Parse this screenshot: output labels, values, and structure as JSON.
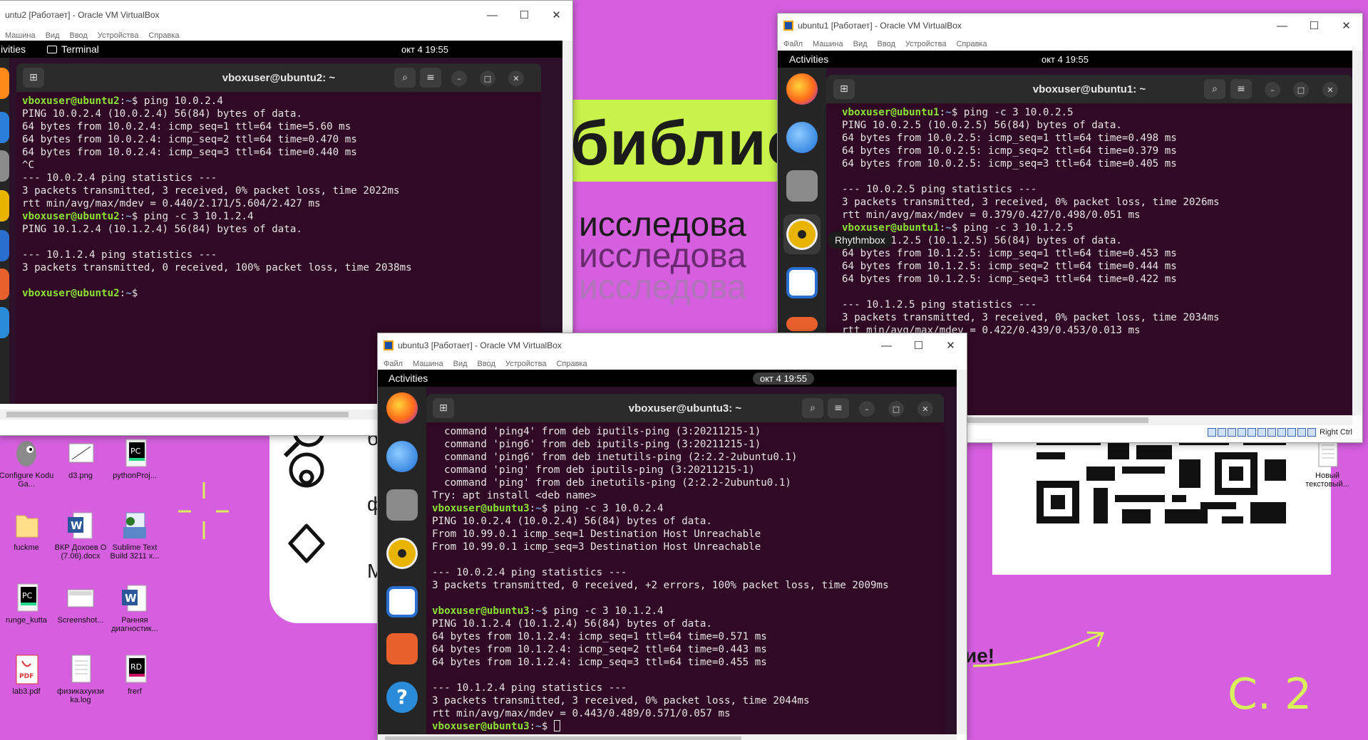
{
  "wallpaper": {
    "big_word": "библио",
    "research_lines": [
      "исследова",
      "исследова",
      "исследова"
    ],
    "side_letters": [
      "б",
      "ф",
      "М"
    ],
    "bottom_text": "ие!",
    "scribble": "С. 2"
  },
  "desktop_icons": [
    {
      "label": "Configure Kodu Ga...",
      "icon": "kodu-icon"
    },
    {
      "label": "d3.png",
      "icon": "image-file-icon"
    },
    {
      "label": "pythonProj...",
      "icon": "pycharm-icon"
    },
    {
      "label": "fuckme",
      "icon": "folder-icon"
    },
    {
      "label": "ВКР Дохоев О (7.06).docx",
      "icon": "word-icon"
    },
    {
      "label": "Sublime Text Build 3211 x...",
      "icon": "installer-icon"
    },
    {
      "label": "runge_kutta",
      "icon": "pycharm-icon"
    },
    {
      "label": "Screenshot...",
      "icon": "image-file-icon"
    },
    {
      "label": "Ранняя диагностик...",
      "icon": "word-icon"
    },
    {
      "label": "lab3.pdf",
      "icon": "pdf-icon"
    },
    {
      "label": "физикахуизи ka.log",
      "icon": "text-file-icon"
    },
    {
      "label": "frerf",
      "icon": "rider-icon"
    },
    {
      "label": "Новый текстовый...",
      "icon": "text-file-icon"
    }
  ],
  "vbox_menu": [
    "Файл",
    "Машина",
    "Вид",
    "Ввод",
    "Устройства",
    "Справка"
  ],
  "win_ubuntu2": {
    "title": "untu2 [Работает] - Oracle VM VirtualBox",
    "menu": [
      "Машина",
      "Вид",
      "Ввод",
      "Устройства",
      "Справка"
    ],
    "activities": "ivities",
    "app_name": "Terminal",
    "clock": "окт 4  19:55",
    "terminal_title": "vboxuser@ubuntu2: ~",
    "lines": [
      {
        "prompt": "vboxuser@ubuntu2",
        "path": "~",
        "cmd": "$ ping 10.0.2.4"
      },
      {
        "text": "PING 10.0.2.4 (10.0.2.4) 56(84) bytes of data."
      },
      {
        "text": "64 bytes from 10.0.2.4: icmp_seq=1 ttl=64 time=5.60 ms"
      },
      {
        "text": "64 bytes from 10.0.2.4: icmp_seq=2 ttl=64 time=0.470 ms"
      },
      {
        "text": "64 bytes from 10.0.2.4: icmp_seq=3 ttl=64 time=0.440 ms"
      },
      {
        "text": "^C"
      },
      {
        "text": "--- 10.0.2.4 ping statistics ---"
      },
      {
        "text": "3 packets transmitted, 3 received, 0% packet loss, time 2022ms"
      },
      {
        "text": "rtt min/avg/max/mdev = 0.440/2.171/5.604/2.427 ms"
      },
      {
        "prompt": "vboxuser@ubuntu2",
        "path": "~",
        "cmd": "$ ping -c 3 10.1.2.4"
      },
      {
        "text": "PING 10.1.2.4 (10.1.2.4) 56(84) bytes of data."
      },
      {
        "text": ""
      },
      {
        "text": "--- 10.1.2.4 ping statistics ---"
      },
      {
        "text": "3 packets transmitted, 0 received, 100% packet loss, time 2038ms"
      },
      {
        "text": ""
      },
      {
        "prompt": "vboxuser@ubuntu2",
        "path": "~",
        "cmd": "$ "
      }
    ]
  },
  "win_ubuntu1": {
    "title": "ubuntu1 [Работает] - Oracle VM VirtualBox",
    "activities": "Activities",
    "clock": "окт 4  19:55",
    "terminal_title": "vboxuser@ubuntu1: ~",
    "tooltip": "Rhythmbox",
    "host_key": "Right Ctrl",
    "lines": [
      {
        "prompt": "vboxuser@ubuntu1",
        "path": "~",
        "cmd": "$ ping -c 3 10.0.2.5"
      },
      {
        "text": "PING 10.0.2.5 (10.0.2.5) 56(84) bytes of data."
      },
      {
        "text": "64 bytes from 10.0.2.5: icmp_seq=1 ttl=64 time=0.498 ms"
      },
      {
        "text": "64 bytes from 10.0.2.5: icmp_seq=2 ttl=64 time=0.379 ms"
      },
      {
        "text": "64 bytes from 10.0.2.5: icmp_seq=3 ttl=64 time=0.405 ms"
      },
      {
        "text": ""
      },
      {
        "text": "--- 10.0.2.5 ping statistics ---"
      },
      {
        "text": "3 packets transmitted, 3 received, 0% packet loss, time 2026ms"
      },
      {
        "text": "rtt min/avg/max/mdev = 0.379/0.427/0.498/0.051 ms"
      },
      {
        "prompt": "vboxuser@ubuntu1",
        "path": "~",
        "cmd": "$ ping -c 3 10.1.2.5"
      },
      {
        "text": "PING 10.1.2.5 (10.1.2.5) 56(84) bytes of data."
      },
      {
        "text": "64 bytes from 10.1.2.5: icmp_seq=1 ttl=64 time=0.453 ms"
      },
      {
        "text": "64 bytes from 10.1.2.5: icmp_seq=2 ttl=64 time=0.444 ms"
      },
      {
        "text": "64 bytes from 10.1.2.5: icmp_seq=3 ttl=64 time=0.422 ms"
      },
      {
        "text": ""
      },
      {
        "text": "--- 10.1.2.5 ping statistics ---"
      },
      {
        "text": "3 packets transmitted, 3 received, 0% packet loss, time 2034ms"
      },
      {
        "text": "rtt min/avg/max/mdev = 0.422/0.439/0.453/0.013 ms"
      }
    ]
  },
  "win_ubuntu3": {
    "title": "ubuntu3 [Работает] - Oracle VM VirtualBox",
    "activities": "Activities",
    "clock": "окт 4  19:55",
    "terminal_title": "vboxuser@ubuntu3: ~",
    "lines": [
      {
        "text": "  command 'ping4' from deb iputils-ping (3:20211215-1)"
      },
      {
        "text": "  command 'ping6' from deb iputils-ping (3:20211215-1)"
      },
      {
        "text": "  command 'ping6' from deb inetutils-ping (2:2.2-2ubuntu0.1)"
      },
      {
        "text": "  command 'ping' from deb iputils-ping (3:20211215-1)"
      },
      {
        "text": "  command 'ping' from deb inetutils-ping (2:2.2-2ubuntu0.1)"
      },
      {
        "text": "Try: apt install <deb name>"
      },
      {
        "prompt": "vboxuser@ubuntu3",
        "path": "~",
        "cmd": "$ ping -c 3 10.0.2.4"
      },
      {
        "text": "PING 10.0.2.4 (10.0.2.4) 56(84) bytes of data."
      },
      {
        "text": "From 10.99.0.1 icmp_seq=1 Destination Host Unreachable"
      },
      {
        "text": "From 10.99.0.1 icmp_seq=3 Destination Host Unreachable"
      },
      {
        "text": ""
      },
      {
        "text": "--- 10.0.2.4 ping statistics ---"
      },
      {
        "text": "3 packets transmitted, 0 received, +2 errors, 100% packet loss, time 2009ms"
      },
      {
        "text": ""
      },
      {
        "prompt": "vboxuser@ubuntu3",
        "path": "~",
        "cmd": "$ ping -c 3 10.1.2.4"
      },
      {
        "text": "PING 10.1.2.4 (10.1.2.4) 56(84) bytes of data."
      },
      {
        "text": "64 bytes from 10.1.2.4: icmp_seq=1 ttl=64 time=0.571 ms"
      },
      {
        "text": "64 bytes from 10.1.2.4: icmp_seq=2 ttl=64 time=0.443 ms"
      },
      {
        "text": "64 bytes from 10.1.2.4: icmp_seq=3 ttl=64 time=0.455 ms"
      },
      {
        "text": ""
      },
      {
        "text": "--- 10.1.2.4 ping statistics ---"
      },
      {
        "text": "3 packets transmitted, 3 received, 0% packet loss, time 2044ms"
      },
      {
        "text": "rtt min/avg/max/mdev = 0.443/0.489/0.571/0.057 ms"
      },
      {
        "prompt": "vboxuser@ubuntu3",
        "path": "~",
        "cmd": "$ ",
        "cursor": true
      }
    ]
  },
  "colors": {
    "wallpaper": "#d65fe0",
    "lime": "#c9f24a",
    "terminal_bg": "#300a24",
    "prompt_user": "#8ae234",
    "prompt_path": "#729fcf"
  }
}
